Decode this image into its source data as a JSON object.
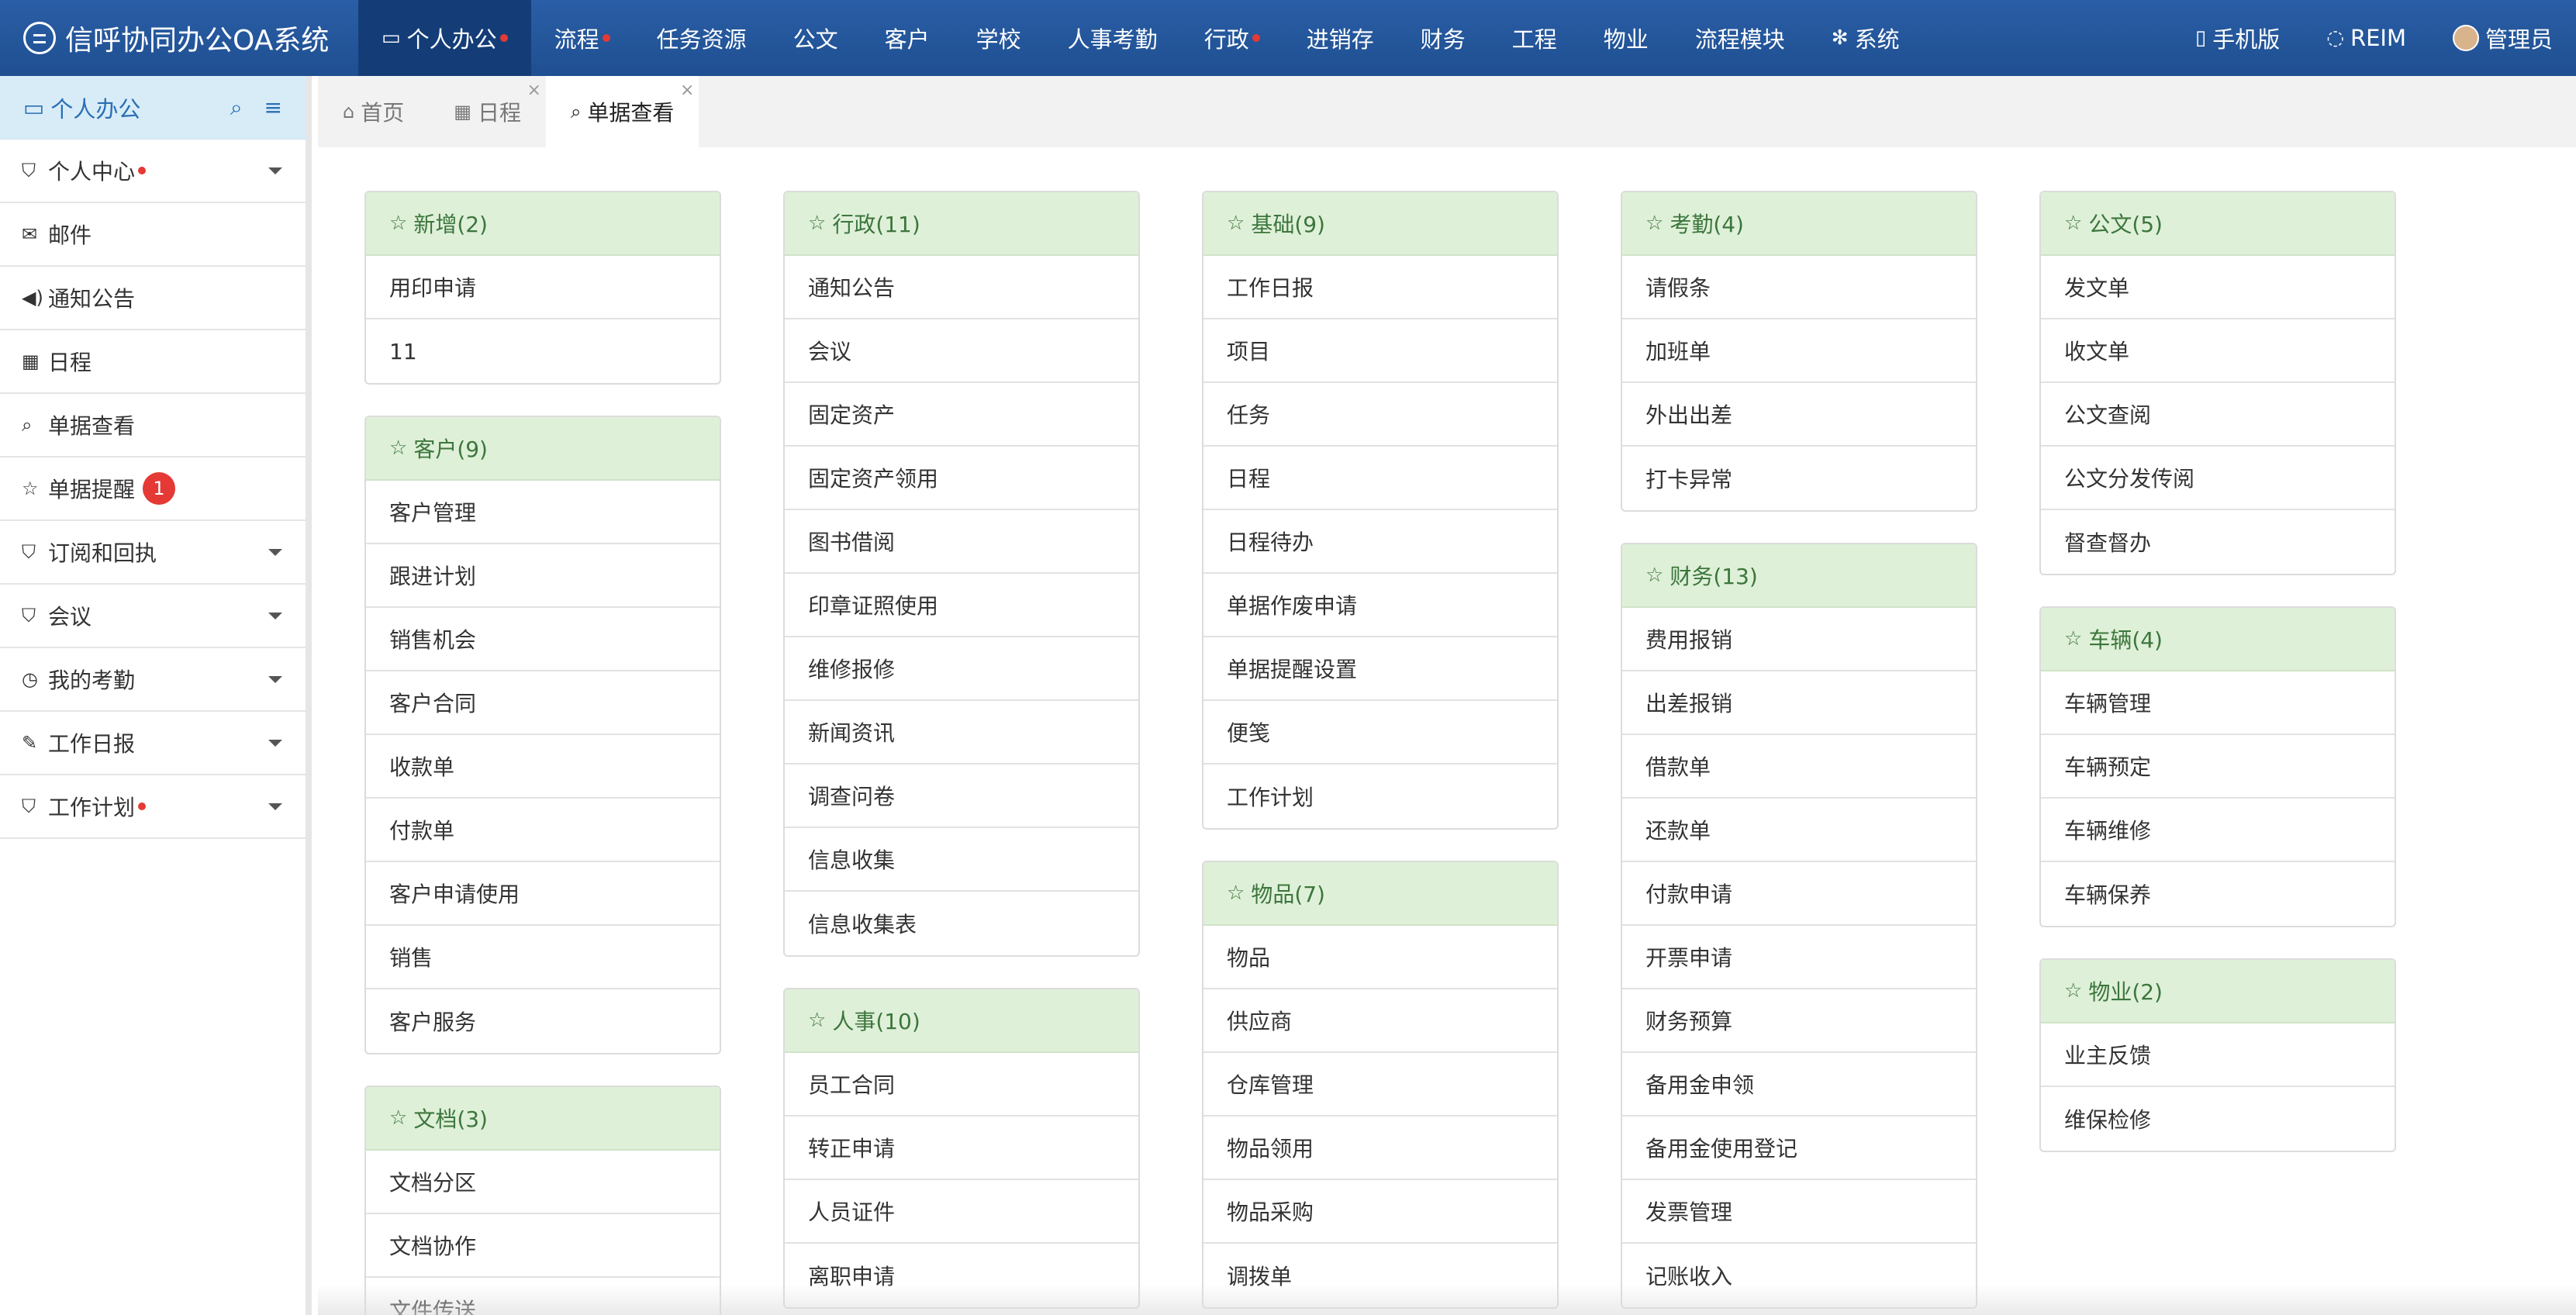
{
  "app": {
    "title": "信呼协同办公OA系统"
  },
  "topnav": {
    "items": [
      {
        "label": "个人办公",
        "icon": "desktop-icon",
        "dot": true,
        "active": true
      },
      {
        "label": "流程",
        "dot": true
      },
      {
        "label": "任务资源"
      },
      {
        "label": "公文"
      },
      {
        "label": "客户"
      },
      {
        "label": "学校"
      },
      {
        "label": "人事考勤"
      },
      {
        "label": "行政",
        "dot": true
      },
      {
        "label": "进销存"
      },
      {
        "label": "财务"
      },
      {
        "label": "工程"
      },
      {
        "label": "物业"
      },
      {
        "label": "流程模块"
      },
      {
        "label": "系统",
        "icon": "gear-icon"
      }
    ],
    "right": {
      "mobile_label": "手机版",
      "reim_label": "REIM",
      "user_label": "管理员"
    }
  },
  "sidebar": {
    "title": "个人办公",
    "items": [
      {
        "label": "个人中心",
        "icon": "bookmark-icon",
        "dot": true,
        "caret": true
      },
      {
        "label": "邮件",
        "icon": "envelope-icon"
      },
      {
        "label": "通知公告",
        "icon": "volume-icon"
      },
      {
        "label": "日程",
        "icon": "calendar-icon"
      },
      {
        "label": "单据查看",
        "icon": "search-icon"
      },
      {
        "label": "单据提醒",
        "icon": "star-icon",
        "badge": "1"
      },
      {
        "label": "订阅和回执",
        "icon": "bookmark-icon",
        "caret": true
      },
      {
        "label": "会议",
        "icon": "bookmark-icon",
        "caret": true
      },
      {
        "label": "我的考勤",
        "icon": "clock-icon",
        "caret": true
      },
      {
        "label": "工作日报",
        "icon": "edit-icon",
        "caret": true
      },
      {
        "label": "工作计划",
        "icon": "bookmark-icon",
        "dot": true,
        "caret": true
      }
    ]
  },
  "tabs": [
    {
      "label": "首页",
      "icon": "home-icon"
    },
    {
      "label": "日程",
      "icon": "calendar-icon",
      "closable": true
    },
    {
      "label": "单据查看",
      "icon": "search-icon",
      "closable": true,
      "active": true
    }
  ],
  "columns": [
    [
      {
        "title": "新增(2)",
        "items": [
          "用印申请",
          "11"
        ]
      },
      {
        "title": "客户(9)",
        "items": [
          "客户管理",
          "跟进计划",
          "销售机会",
          "客户合同",
          "收款单",
          "付款单",
          "客户申请使用",
          "销售",
          "客户服务"
        ]
      },
      {
        "title": "文档(3)",
        "items": [
          "文档分区",
          "文档协作",
          "文件传送"
        ]
      }
    ],
    [
      {
        "title": "行政(11)",
        "items": [
          "通知公告",
          "会议",
          "固定资产",
          "固定资产领用",
          "图书借阅",
          "印章证照使用",
          "维修报修",
          "新闻资讯",
          "调查问卷",
          "信息收集",
          "信息收集表"
        ]
      },
      {
        "title": "人事(10)",
        "items": [
          "员工合同",
          "转正申请",
          "人员证件",
          "离职申请"
        ]
      }
    ],
    [
      {
        "title": "基础(9)",
        "items": [
          "工作日报",
          "项目",
          "任务",
          "日程",
          "日程待办",
          "单据作废申请",
          "单据提醒设置",
          "便笺",
          "工作计划"
        ]
      },
      {
        "title": "物品(7)",
        "items": [
          "物品",
          "供应商",
          "仓库管理",
          "物品领用",
          "物品采购",
          "调拨单"
        ]
      }
    ],
    [
      {
        "title": "考勤(4)",
        "items": [
          "请假条",
          "加班单",
          "外出出差",
          "打卡异常"
        ]
      },
      {
        "title": "财务(13)",
        "items": [
          "费用报销",
          "出差报销",
          "借款单",
          "还款单",
          "付款申请",
          "开票申请",
          "财务预算",
          "备用金申领",
          "备用金使用登记",
          "发票管理",
          "记账收入"
        ]
      }
    ],
    [
      {
        "title": "公文(5)",
        "items": [
          "发文单",
          "收文单",
          "公文查阅",
          "公文分发传阅",
          "督查督办"
        ]
      },
      {
        "title": "车辆(4)",
        "items": [
          "车辆管理",
          "车辆预定",
          "车辆维修",
          "车辆保养"
        ]
      },
      {
        "title": "物业(2)",
        "items": [
          "业主反馈",
          "维保检修"
        ]
      }
    ]
  ],
  "colors": {
    "topbar": "#1f4f91",
    "card_head_bg": "#dff0d8",
    "card_head_text": "#3c763d",
    "badge": "#e53935"
  }
}
